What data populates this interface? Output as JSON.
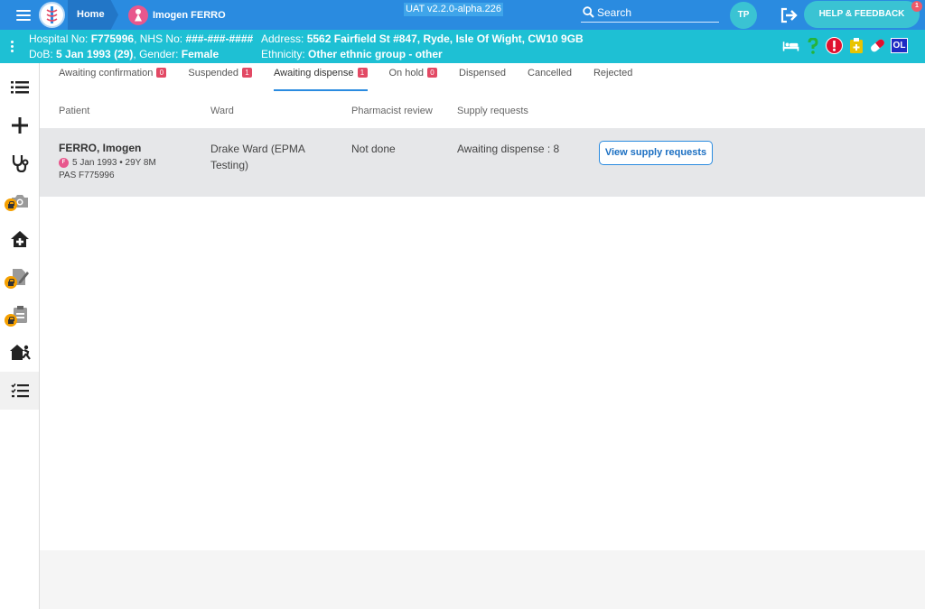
{
  "topbar": {
    "home_label": "Home",
    "patient_label": "Imogen FERRO",
    "env_version": "UAT v2.2.0-alpha.226",
    "search_label": "Search",
    "user_initials": "TP",
    "help_label": "HELP & FEEDBACK",
    "help_badge": "1",
    "accent_color": "#2a8be0"
  },
  "banner": {
    "hospital_no_label": "Hospital No: ",
    "hospital_no": "F775996",
    "nhs_no_label": ", NHS No: ",
    "nhs_no": "###-###-####",
    "dob_label": "DoB: ",
    "dob": "5 Jan 1993 (29)",
    "gender_label": ", Gender: ",
    "gender": "Female",
    "address_label": "Address: ",
    "address": "5562 Fairfield St #847, Ryde, Isle Of Wight, CW10 9GB",
    "ethnicity_label": "Ethnicity: ",
    "ethnicity": "Other ethnic group - other",
    "ol_badge": "OL",
    "icons": [
      "bed-icon",
      "question-icon",
      "alert-icon",
      "clipboard-plus-icon",
      "pill-icon"
    ]
  },
  "tabs": [
    {
      "label": "Awaiting confirmation",
      "count": "0"
    },
    {
      "label": "Suspended",
      "count": "1"
    },
    {
      "label": "Awaiting dispense",
      "count": "1"
    },
    {
      "label": "On hold",
      "count": "0"
    },
    {
      "label": "Dispensed"
    },
    {
      "label": "Cancelled"
    },
    {
      "label": "Rejected"
    }
  ],
  "columns": {
    "patient": "Patient",
    "ward": "Ward",
    "pharmacist_review": "Pharmacist review",
    "supply_requests": "Supply requests"
  },
  "row": {
    "name": "FERRO, Imogen",
    "sex_badge": "F",
    "dob_age": "5 Jan 1993 • 29Y 8M",
    "pas": "PAS F775996",
    "ward": "Drake Ward (EPMA Testing)",
    "pharmacist_review": "Not done",
    "supply_status": "Awaiting dispense : 8",
    "button_label": "View supply requests"
  },
  "nav_icons": [
    "list-icon",
    "plus-icon",
    "stethoscope-icon",
    "camera-icon",
    "home-medical-icon",
    "document-edit-icon",
    "clipboard-icon",
    "home-run-icon",
    "checklist-icon"
  ]
}
